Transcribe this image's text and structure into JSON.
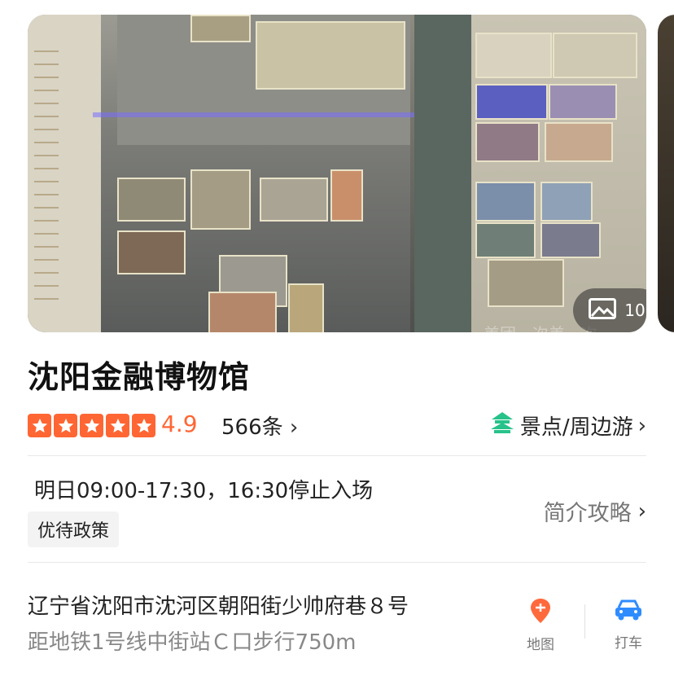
{
  "gallery": {
    "photo_count": "10",
    "watermark": "美团一次美一次"
  },
  "poi": {
    "title": "沈阳金融博物馆",
    "rating": "4.9",
    "review_count": "566条",
    "category": "景点/周边游"
  },
  "info": {
    "hours": "明日09:00-17:30，16:30停止入场",
    "policy_tag": "优待政策",
    "guide_link": "简介攻略"
  },
  "location": {
    "address": "辽宁省沈阳市沈河区朝阳街少帅府巷８号",
    "metro": "距地铁1号线中街站Ｃ口步行750m",
    "map_label": "地图",
    "taxi_label": "打车"
  },
  "colors": {
    "accent_orange": "#ff6633",
    "map_icon": "#ff6a3d",
    "taxi_icon": "#2f8cff",
    "category_icon": "#27c28a"
  },
  "icons": [
    "image-icon",
    "star-icon",
    "scenic-icon",
    "chevron-right-icon",
    "map-pin-icon",
    "car-icon"
  ]
}
